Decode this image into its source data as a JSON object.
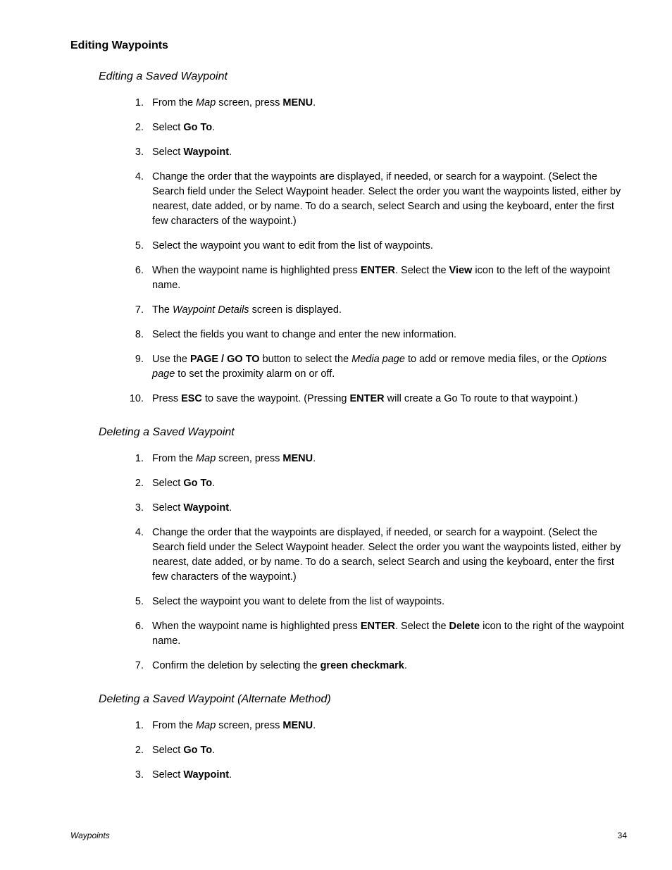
{
  "title": "Editing Waypoints",
  "sections": [
    {
      "heading": "Editing a Saved Waypoint",
      "steps": [
        [
          {
            "t": "From the "
          },
          {
            "t": "Map",
            "s": "i"
          },
          {
            "t": " screen, press "
          },
          {
            "t": "MENU",
            "s": "b"
          },
          {
            "t": "."
          }
        ],
        [
          {
            "t": "Select "
          },
          {
            "t": "Go To",
            "s": "b"
          },
          {
            "t": "."
          }
        ],
        [
          {
            "t": "Select "
          },
          {
            "t": "Waypoint",
            "s": "b"
          },
          {
            "t": "."
          }
        ],
        [
          {
            "t": "Change the order that the waypoints are displayed, if needed, or search for a waypoint. (Select the Search field under the Select Waypoint header.  Select the order you want the waypoints listed, either by nearest, date added, or by name.  To do a search, select Search and using the keyboard, enter the first few characters of the waypoint.)"
          }
        ],
        [
          {
            "t": "Select the waypoint you want to edit from the list of waypoints."
          }
        ],
        [
          {
            "t": "When the waypoint name is highlighted press "
          },
          {
            "t": "ENTER",
            "s": "b"
          },
          {
            "t": ".  Select the "
          },
          {
            "t": "View",
            "s": "b"
          },
          {
            "t": " icon to the left of the waypoint name."
          }
        ],
        [
          {
            "t": "The "
          },
          {
            "t": "Waypoint Details",
            "s": "i"
          },
          {
            "t": " screen is displayed."
          }
        ],
        [
          {
            "t": "Select the fields you want to change and enter the new information."
          }
        ],
        [
          {
            "t": "Use the "
          },
          {
            "t": "PAGE / GO TO",
            "s": "b"
          },
          {
            "t": " button to select the "
          },
          {
            "t": "Media page",
            "s": "i"
          },
          {
            "t": " to add or remove media files, or the "
          },
          {
            "t": "Options page",
            "s": "i"
          },
          {
            "t": " to set the proximity alarm on or off."
          }
        ],
        [
          {
            "t": "Press "
          },
          {
            "t": "ESC",
            "s": "b"
          },
          {
            "t": " to save the waypoint.  (Pressing "
          },
          {
            "t": "ENTER",
            "s": "b"
          },
          {
            "t": " will create a Go To route to that waypoint.)"
          }
        ]
      ]
    },
    {
      "heading": "Deleting a Saved Waypoint",
      "steps": [
        [
          {
            "t": "From the "
          },
          {
            "t": "Map",
            "s": "i"
          },
          {
            "t": " screen, press "
          },
          {
            "t": "MENU",
            "s": "b"
          },
          {
            "t": "."
          }
        ],
        [
          {
            "t": "Select "
          },
          {
            "t": "Go To",
            "s": "b"
          },
          {
            "t": "."
          }
        ],
        [
          {
            "t": "Select "
          },
          {
            "t": "Waypoint",
            "s": "b"
          },
          {
            "t": "."
          }
        ],
        [
          {
            "t": "Change the order that the waypoints are displayed, if needed, or search for a waypoint. (Select the Search field under the Select Waypoint header.  Select the order you want the waypoints listed, either by nearest, date added, or by name.  To do a search, select Search and using the keyboard, enter the first few characters of the waypoint.)"
          }
        ],
        [
          {
            "t": "Select the waypoint you want to delete from the list of waypoints."
          }
        ],
        [
          {
            "t": "When the waypoint name is highlighted press "
          },
          {
            "t": "ENTER",
            "s": "b"
          },
          {
            "t": ".  Select the "
          },
          {
            "t": "Delete",
            "s": "b"
          },
          {
            "t": " icon to the right of the waypoint name."
          }
        ],
        [
          {
            "t": "Confirm the deletion by selecting the "
          },
          {
            "t": "green checkmark",
            "s": "b"
          },
          {
            "t": "."
          }
        ]
      ]
    },
    {
      "heading": "Deleting a Saved Waypoint (Alternate Method)",
      "steps": [
        [
          {
            "t": "From the "
          },
          {
            "t": "Map",
            "s": "i"
          },
          {
            "t": " screen, press "
          },
          {
            "t": "MENU",
            "s": "b"
          },
          {
            "t": "."
          }
        ],
        [
          {
            "t": "Select "
          },
          {
            "t": "Go To",
            "s": "b"
          },
          {
            "t": "."
          }
        ],
        [
          {
            "t": "Select "
          },
          {
            "t": "Waypoint",
            "s": "b"
          },
          {
            "t": "."
          }
        ]
      ]
    }
  ],
  "footer": {
    "left": "Waypoints",
    "right": "34"
  }
}
